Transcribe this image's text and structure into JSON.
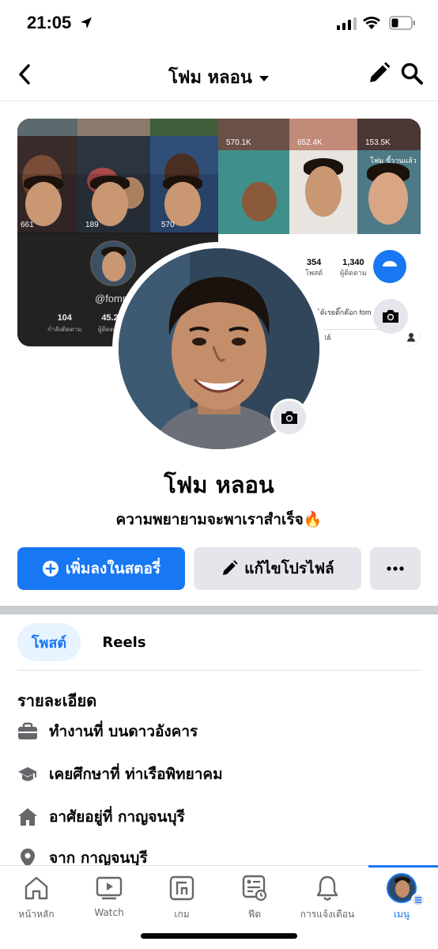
{
  "status": {
    "time": "21:05"
  },
  "nav": {
    "title": "โฟม หลอน"
  },
  "cover": {
    "views": [
      "570.1K",
      "652.4K",
      "153.5K",
      "661",
      "189",
      "570"
    ],
    "thumb_caption": "โฟม ขี้วานแล้ว",
    "tiktok_handle": "@fomn",
    "tiktok_following": "104",
    "tiktok_following_label": "กำลังติดตาม",
    "tiktok_followers": "45.2",
    "tiktok_followers_label": "ผู้ติดตาม",
    "right_posts": "354",
    "right_posts_label": "โพสต์",
    "right_followers": "1,340",
    "right_followers_label": "ผู้ติดตาม",
    "right_bio": "ั้งได้เรยติ๊กต๊อก fom",
    "right_btn": "ไฟล์"
  },
  "profile": {
    "name": "โฟม หลอน",
    "bio": "ความพยายามจะพาเราสำเร็จ🔥"
  },
  "actions": {
    "add_story": "เพิ่มลงในสตอรี่",
    "edit_profile": "แก้ไขโปรไฟล์"
  },
  "tabs": {
    "posts": "โพสต์",
    "reels": "Reels"
  },
  "details": {
    "title": "รายละเอียด",
    "items": [
      {
        "icon": "briefcase-icon",
        "text": "ทำงานที่ บนดาวอังคาร"
      },
      {
        "icon": "graduation-cap-icon",
        "text": "เคยศึกษาที่ ท่าเรือพิทยาคม"
      },
      {
        "icon": "house-icon",
        "text": "อาศัยอยู่ที่ กาญจนบุรี"
      },
      {
        "icon": "location-pin-icon",
        "text": "จาก กาญจนบุรี"
      }
    ]
  },
  "bottom_nav": {
    "items": [
      {
        "label": "หน้าหลัก",
        "icon": "home-icon"
      },
      {
        "label": "Watch",
        "icon": "watch-icon"
      },
      {
        "label": "เกม",
        "icon": "gaming-icon"
      },
      {
        "label": "ฟีด",
        "icon": "feeds-icon"
      },
      {
        "label": "การแจ้งเตือน",
        "icon": "bell-icon"
      },
      {
        "label": "เมนู",
        "icon": "menu-avatar",
        "active": true
      }
    ]
  },
  "colors": {
    "accent": "#1877f2",
    "secondary_button": "#e4e6eb",
    "text": "#050505"
  }
}
